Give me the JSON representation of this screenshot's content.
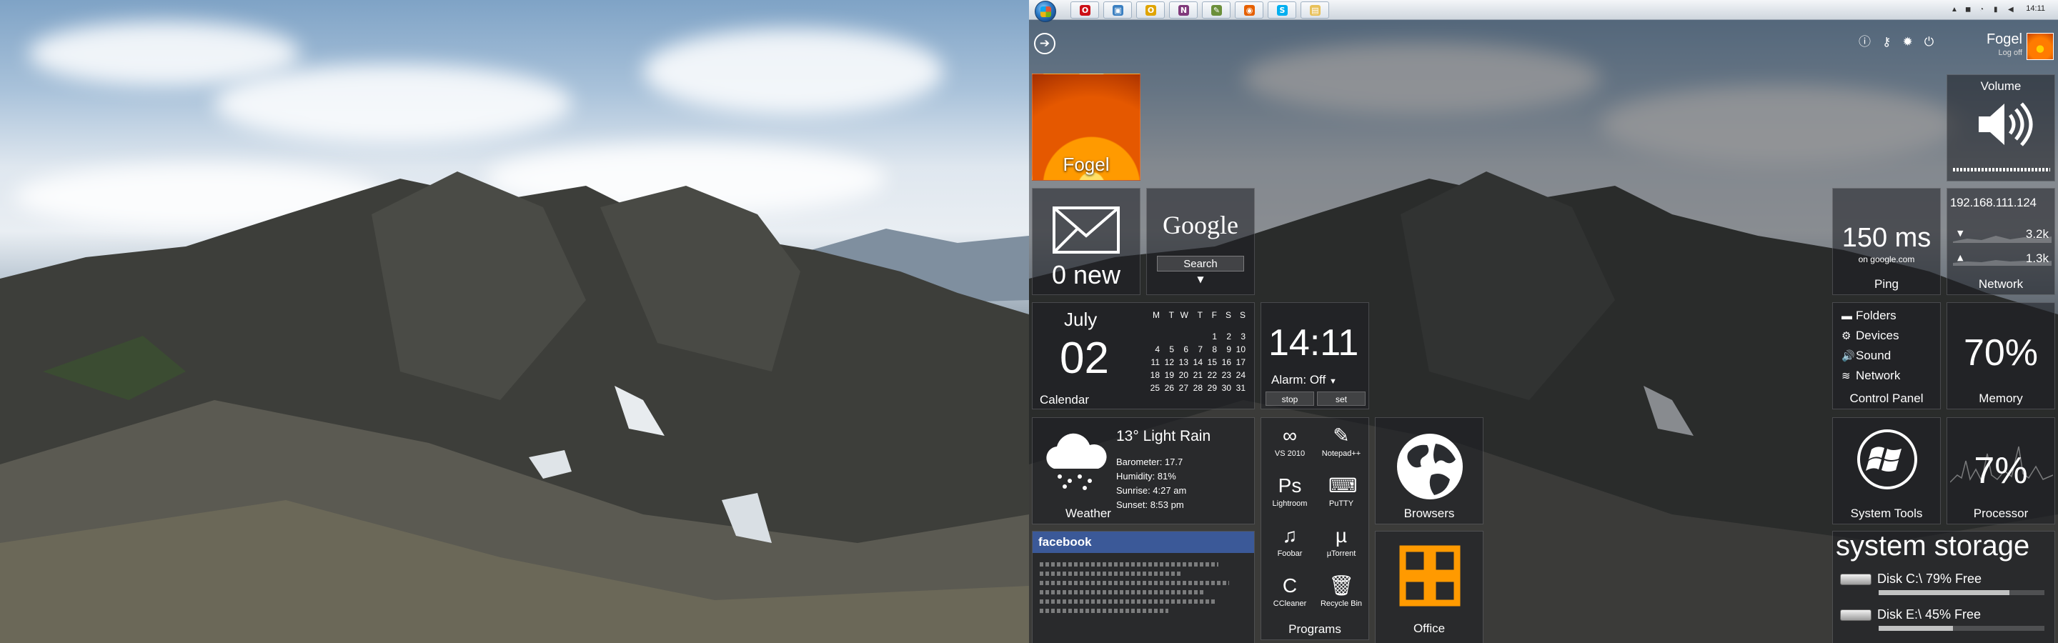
{
  "taskbar": {
    "apps": [
      {
        "icon": "opera-icon",
        "glyph": "O",
        "color": "#cc0f16"
      },
      {
        "icon": "monitor-icon",
        "glyph": "▣",
        "color": "#3a7fc1"
      },
      {
        "icon": "outlook-icon",
        "glyph": "O",
        "color": "#e0a400"
      },
      {
        "icon": "onenote-icon",
        "glyph": "N",
        "color": "#80397b"
      },
      {
        "icon": "notepad-icon",
        "glyph": "✎",
        "color": "#6b8f3a"
      },
      {
        "icon": "firefox-icon",
        "glyph": "◉",
        "color": "#e66000"
      },
      {
        "icon": "skype-icon",
        "glyph": "S",
        "color": "#00aff0"
      },
      {
        "icon": "explorer-folder-icon",
        "glyph": "▤",
        "color": "#e8c15a"
      }
    ],
    "clock": "14:11"
  },
  "header": {
    "user_name": "Fogel",
    "log_off": "Log off"
  },
  "tiles": {
    "user_tile": {
      "label": "Fogel"
    },
    "mail": {
      "count": "0 new"
    },
    "google": {
      "logo": "Google",
      "search_label": "Search"
    },
    "calendar": {
      "month": "July",
      "day": "02",
      "label": "Calendar",
      "weekdays": [
        "M",
        "T",
        "W",
        "T",
        "F",
        "S",
        "S"
      ],
      "weeks": [
        [
          "",
          "",
          "",
          "",
          "1",
          "2",
          "3"
        ],
        [
          "4",
          "5",
          "6",
          "7",
          "8",
          "9",
          "10"
        ],
        [
          "11",
          "12",
          "13",
          "14",
          "15",
          "16",
          "17"
        ],
        [
          "18",
          "19",
          "20",
          "21",
          "22",
          "23",
          "24"
        ],
        [
          "25",
          "26",
          "27",
          "28",
          "29",
          "30",
          "31"
        ]
      ]
    },
    "clock": {
      "time": "14:11",
      "alarm": "Alarm: Off",
      "stop": "stop",
      "set": "set"
    },
    "weather": {
      "condition": "13° Light Rain",
      "barometer": "Barometer: 17.7",
      "humidity": "Humidity: 81%",
      "sunrise": "Sunrise: 4:27 am",
      "sunset": "Sunset: 8:53 pm",
      "label": "Weather"
    },
    "facebook": {
      "title": "facebook"
    },
    "programs": {
      "label": "Programs",
      "items": [
        {
          "name": "VS 2010",
          "glyph": "∞"
        },
        {
          "name": "Notepad++",
          "glyph": "✎"
        },
        {
          "name": "Lightroom",
          "glyph": "Ps"
        },
        {
          "name": "PuTTY",
          "glyph": "⌨"
        },
        {
          "name": "Foobar",
          "glyph": "♫"
        },
        {
          "name": "µTorrent",
          "glyph": "µ"
        },
        {
          "name": "CCleaner",
          "glyph": "C"
        },
        {
          "name": "Recycle Bin",
          "glyph": "🗑"
        }
      ]
    },
    "browsers": {
      "label": "Browsers"
    },
    "office": {
      "label": "Office"
    },
    "ping": {
      "value": "150 ms",
      "host": "on google.com",
      "label": "Ping"
    },
    "network": {
      "ip": "192.168.111.124",
      "down": "3.2k",
      "up": "1.3k",
      "label": "Network"
    },
    "volume": {
      "label": "Volume",
      "level": 1.0
    },
    "control_panel": {
      "label": "Control Panel",
      "items": [
        {
          "name": "Folders",
          "glyph": "▬"
        },
        {
          "name": "Devices",
          "glyph": "⚙"
        },
        {
          "name": "Sound",
          "glyph": "🔊"
        },
        {
          "name": "Network",
          "glyph": "≋"
        }
      ]
    },
    "memory": {
      "value": "70%",
      "label": "Memory"
    },
    "system_tools": {
      "label": "System Tools"
    },
    "processor": {
      "value": "7%",
      "label": "Processor"
    },
    "storage": {
      "title": "system storage",
      "disks": [
        {
          "text": "Disk C:\\ 79% Free",
          "free": 0.79
        },
        {
          "text": "Disk E:\\ 45% Free",
          "free": 0.45
        }
      ]
    }
  }
}
